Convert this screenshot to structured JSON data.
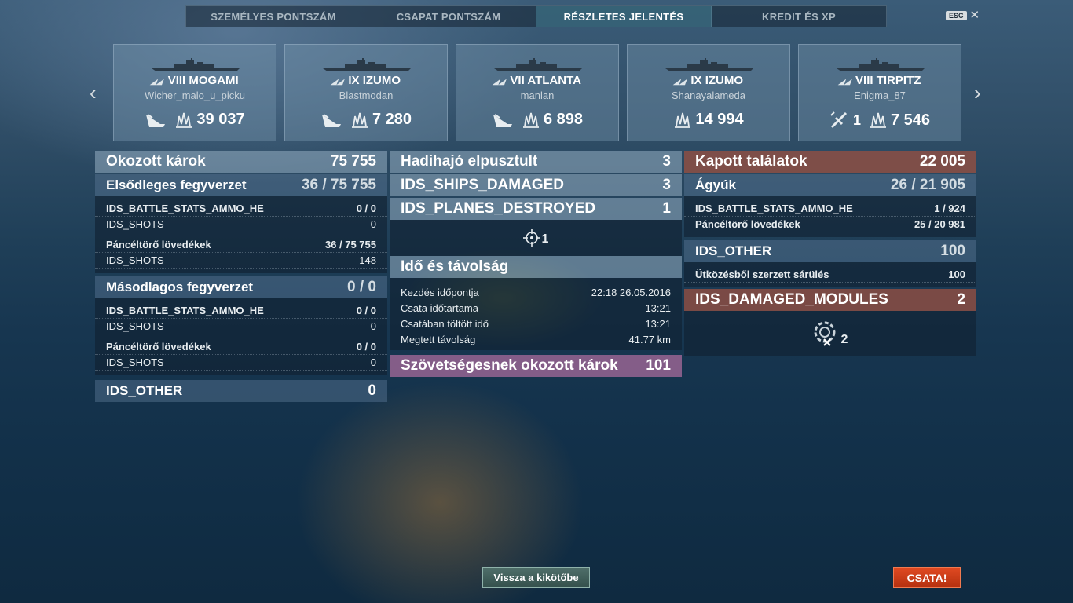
{
  "tabs": [
    "SZEMÉLYES PONTSZÁM",
    "CSAPAT PONTSZÁM",
    "RÉSZLETES JELENTÉS",
    "KREDIT ÉS XP"
  ],
  "active_tab": "RÉSZLETES JELENTÉS",
  "esc_key": "ESC",
  "ships": [
    {
      "tier": "VIII",
      "name": "MOGAMI",
      "player": "Wicher_malo_u_picku",
      "damage": "39 037",
      "kills": "",
      "icon": "ship-sunk-icon"
    },
    {
      "tier": "IX",
      "name": "IZUMO",
      "player": "Blastmodan",
      "damage": "7 280",
      "kills": "",
      "icon": "ship-sunk-icon"
    },
    {
      "tier": "VII",
      "name": "ATLANTA",
      "player": "manlan",
      "damage": "6 898",
      "kills": "",
      "icon": "ship-sunk-icon"
    },
    {
      "tier": "IX",
      "name": "IZUMO",
      "player": "Shanayalameda",
      "damage": "14 994",
      "kills": "",
      "icon": ""
    },
    {
      "tier": "VIII",
      "name": "TIRPITZ",
      "player": "Enigma_87",
      "damage": "7 546",
      "kills": "1",
      "icon": "planes-shot-icon"
    }
  ],
  "left": {
    "total_label": "Okozott károk",
    "total_value": "75 755",
    "primary_label": "Elsődleges fegyverzet",
    "primary_value": "36 / 75 755",
    "primary_rows": [
      {
        "label": "IDS_BATTLE_STATS_AMMO_HE",
        "value": "0 / 0"
      },
      {
        "label": "IDS_SHOTS",
        "value": "0"
      },
      {
        "label": "Páncéltörő lövedékek",
        "value": "36 / 75 755"
      },
      {
        "label": "IDS_SHOTS",
        "value": "148"
      }
    ],
    "secondary_label": "Másodlagos fegyverzet",
    "secondary_value": "0 / 0",
    "secondary_rows": [
      {
        "label": "IDS_BATTLE_STATS_AMMO_HE",
        "value": "0 / 0"
      },
      {
        "label": "IDS_SHOTS",
        "value": "0"
      },
      {
        "label": "Páncéltörő lövedékek",
        "value": "0 / 0"
      },
      {
        "label": "IDS_SHOTS",
        "value": "0"
      }
    ],
    "other_label": "IDS_OTHER",
    "other_value": "0"
  },
  "middle": {
    "destroyed_label": "Hadihajó elpusztult",
    "destroyed_value": "3",
    "damaged_label": "IDS_SHIPS_DAMAGED",
    "damaged_value": "3",
    "planes_label": "IDS_PLANES_DESTROYED",
    "planes_value": "1",
    "crosshair_count": "1",
    "time_label": "Idő és távolság",
    "time_rows": [
      {
        "label": "Kezdés időpontja",
        "value": "22:18  26.05.2016"
      },
      {
        "label": "Csata időtartama",
        "value": "13:21"
      },
      {
        "label": "Csatában töltött idő",
        "value": "13:21"
      },
      {
        "label": "Megtett távolság",
        "value": "41.77 km"
      }
    ],
    "ally_label": "Szövetségesnek okozott károk",
    "ally_value": "101"
  },
  "right": {
    "received_label": "Kapott találatok",
    "received_value": "22 005",
    "guns_label": "Ágyúk",
    "guns_value": "26 / 21 905",
    "guns_rows": [
      {
        "label": "IDS_BATTLE_STATS_AMMO_HE",
        "value": "1 / 924"
      },
      {
        "label": "Páncéltörő lövedékek",
        "value": "25 / 20 981"
      }
    ],
    "other_label": "IDS_OTHER",
    "other_value": "100",
    "other_rows": [
      {
        "label": "Ütközésből szerzett sárülés",
        "value": "100"
      }
    ],
    "modules_label": "IDS_DAMAGED_MODULES",
    "modules_value": "2",
    "module_icon_count": "2"
  },
  "buttons": {
    "port": "Vissza a kikötőbe",
    "battle": "CSATA!"
  },
  "colors": {
    "active_tab": "#3f8a96",
    "received_header": "#96503f",
    "ally_header": "#af6ea0",
    "battle_button": "#d9411b",
    "port_button": "#4f6f6a"
  }
}
